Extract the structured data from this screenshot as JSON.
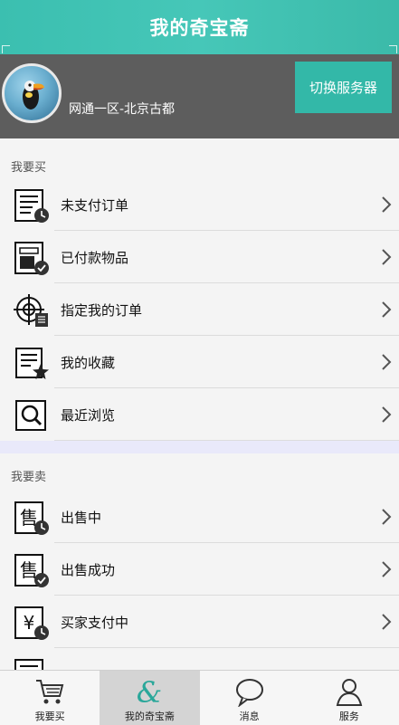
{
  "header": {
    "title": "我的奇宝斋"
  },
  "profile": {
    "server_name": "网通一区-北京古都",
    "switch_label": "切换服务器"
  },
  "buy": {
    "section_title": "我要买",
    "items": [
      {
        "label": "未支付订单",
        "icon": "unpaid-order-icon"
      },
      {
        "label": "已付款物品",
        "icon": "paid-item-icon"
      },
      {
        "label": "指定我的订单",
        "icon": "target-order-icon"
      },
      {
        "label": "我的收藏",
        "icon": "favorites-icon"
      },
      {
        "label": "最近浏览",
        "icon": "recent-browse-icon"
      }
    ]
  },
  "sell": {
    "section_title": "我要卖",
    "items": [
      {
        "label": "出售中",
        "icon": "selling-icon"
      },
      {
        "label": "出售成功",
        "icon": "sold-icon"
      },
      {
        "label": "买家支付中",
        "icon": "buyer-paying-icon"
      }
    ]
  },
  "nav": {
    "items": [
      {
        "label": "我要买",
        "icon": "cart-icon"
      },
      {
        "label": "我的奇宝斋",
        "icon": "ampersand-icon",
        "active": true
      },
      {
        "label": "消息",
        "icon": "message-icon"
      },
      {
        "label": "服务",
        "icon": "person-icon"
      }
    ]
  },
  "colors": {
    "accent": "#3bbfb0",
    "profile_bg": "#5d5d5d",
    "band": "#e9e9fa"
  }
}
